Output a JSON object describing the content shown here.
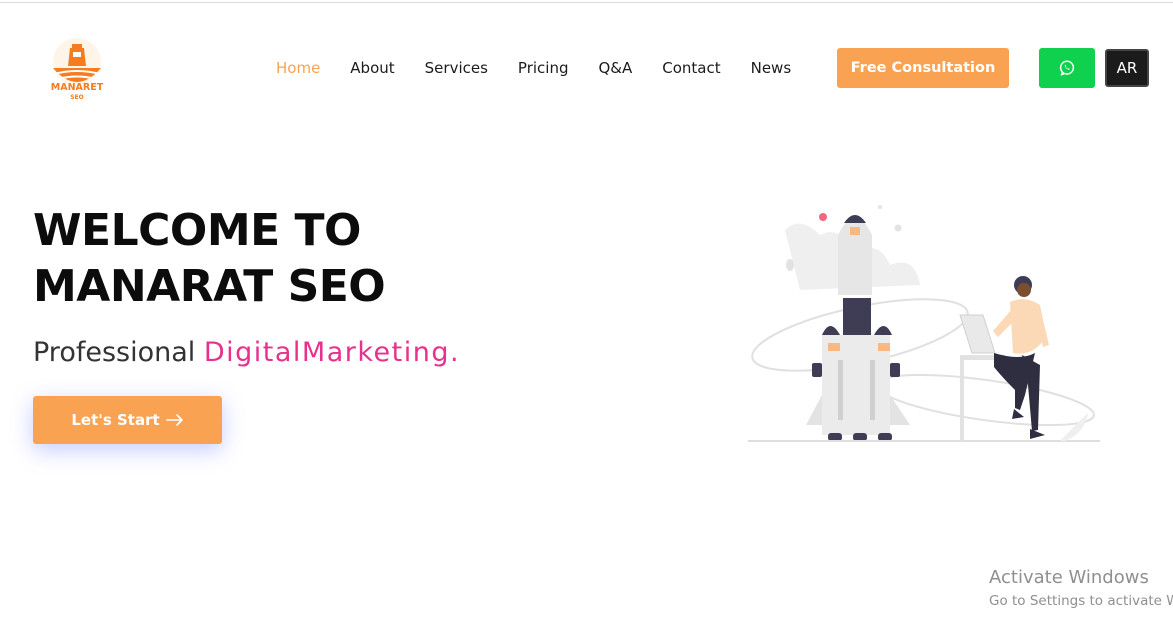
{
  "header": {
    "logo_text": "MANARET",
    "logo_subtext": "SEO",
    "nav": [
      {
        "label": "Home",
        "active": true
      },
      {
        "label": "About",
        "active": false
      },
      {
        "label": "Services",
        "active": false
      },
      {
        "label": "Pricing",
        "active": false
      },
      {
        "label": "Q&A",
        "active": false
      },
      {
        "label": "Contact",
        "active": false
      },
      {
        "label": "News",
        "active": false
      }
    ],
    "cta_label": "Free Consultation",
    "whatsapp_icon": "whatsapp-icon",
    "lang_label": "AR"
  },
  "hero": {
    "title_line1": "WELCOME TO",
    "title_line2": "MANARAT SEO",
    "subtitle_prefix": "Professional",
    "subtitle_accent": "DigitalMarketing.",
    "start_label": "Let's Start",
    "start_icon": "arrow-right-icon",
    "illustration": "rocket-launch-illustration"
  },
  "watermark": {
    "title": "Activate Windows",
    "subtitle": "Go to Settings to activate Windows."
  },
  "colors": {
    "accent_orange": "#f9a352",
    "nav_active": "#f7a351",
    "accent_pink": "#e8308c",
    "whatsapp_green": "#0fd14d",
    "lang_dark": "#1b1b1b"
  }
}
